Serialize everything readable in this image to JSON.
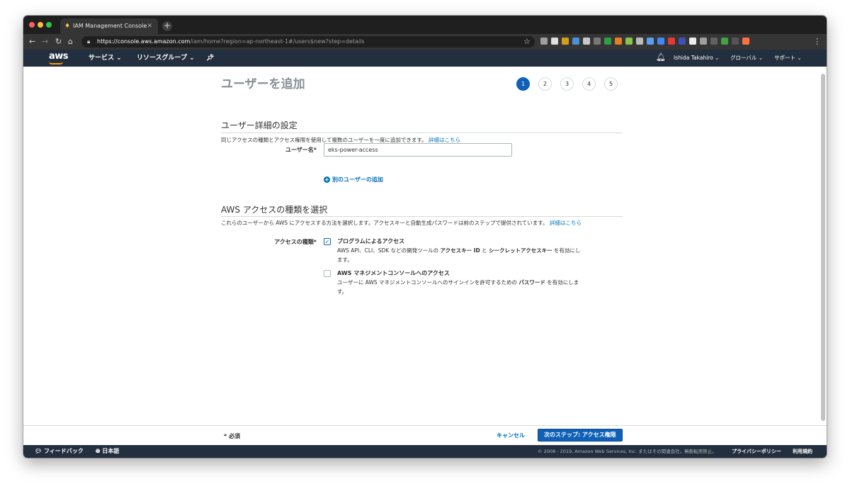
{
  "browser": {
    "tab_title": "IAM Management Console",
    "url_scheme": "https://",
    "url_host": "console.aws.amazon.com",
    "url_path": "/iam/home?region=ap-northeast-1#/users$new?step=details"
  },
  "awsnav": {
    "logo": "aws",
    "services": "サービス ⌄",
    "resource_groups": "リソースグループ ⌄",
    "user": "Ishida Takahiro ⌄",
    "region": "グローバル ⌄",
    "support": "サポート ⌄"
  },
  "page": {
    "title": "ユーザーを追加",
    "steps": [
      "1",
      "2",
      "3",
      "4",
      "5"
    ],
    "active_step": 1
  },
  "details": {
    "title": "ユーザー詳細の設定",
    "description": "同じアクセスの種類とアクセス権限を使用して複数のユーザーを一度に追加できます。",
    "more_link": "詳細はこちら",
    "username_label": "ユーザー名*",
    "username_value": "eks-power-access",
    "add_another": "別のユーザーの追加"
  },
  "access": {
    "title": "AWS アクセスの種類を選択",
    "description": "これらのユーザーから AWS にアクセスする方法を選択します。アクセスキーと自動生成パスワードは前のステップで提供されています。",
    "more_link": "詳細はこちら",
    "type_label": "アクセスの種類*",
    "programmatic": {
      "checked": true,
      "title": "プログラムによるアクセス",
      "desc_a": "AWS API、CLI、SDK などの開発ツールの ",
      "desc_b1": "アクセスキー ID",
      "desc_c": " と ",
      "desc_b2": "シークレットアクセスキー",
      "desc_d": " を有効にします。"
    },
    "console": {
      "checked": false,
      "title": "AWS マネジメントコンソールへのアクセス",
      "desc_a": "ユーザーに AWS マネジメントコンソールへのサインインを許可するための ",
      "desc_b": "パスワード",
      "desc_c": " を有効にします。"
    }
  },
  "footer": {
    "required": "* 必須",
    "cancel": "キャンセル",
    "next": "次のステップ: アクセス権限"
  },
  "bottombar": {
    "feedback": "フィードバック",
    "language": "日本語",
    "copyright": "© 2008 - 2019, Amazon Web Services, Inc. またはその関連会社。無断転用禁止。",
    "privacy": "プライバシーポリシー",
    "terms": "利用規約"
  },
  "colors": {
    "aws_nav": "#232f3e",
    "primary": "#0f60b6",
    "link": "#0073bb",
    "aws_orange": "#ff9900"
  }
}
